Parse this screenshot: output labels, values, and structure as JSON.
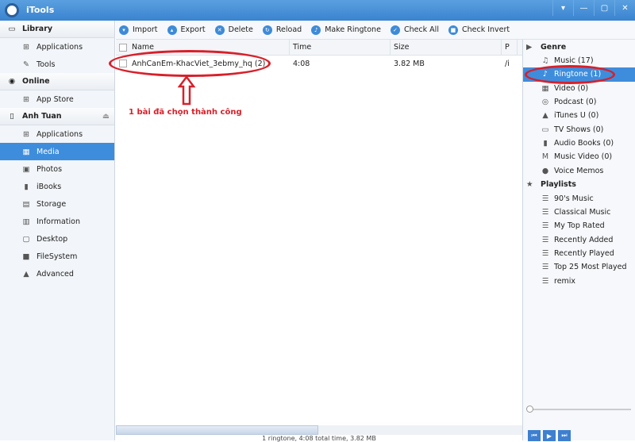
{
  "window": {
    "title": "iTools",
    "controls": [
      "▾",
      "—",
      "▢",
      "✕"
    ]
  },
  "sidebar": {
    "library": {
      "label": "Library",
      "items": [
        {
          "label": "Applications",
          "icon": "grid-icon"
        },
        {
          "label": "Tools",
          "icon": "wrench-icon"
        }
      ]
    },
    "online": {
      "label": "Online",
      "items": [
        {
          "label": "App Store",
          "icon": "grid-icon"
        }
      ]
    },
    "device": {
      "label": "Anh Tuan",
      "items": [
        {
          "label": "Applications"
        },
        {
          "label": "Media"
        },
        {
          "label": "Photos"
        },
        {
          "label": "iBooks"
        },
        {
          "label": "Storage"
        },
        {
          "label": "Information"
        },
        {
          "label": "Desktop"
        },
        {
          "label": "FileSystem"
        },
        {
          "label": "Advanced"
        }
      ],
      "selected": "Media"
    }
  },
  "toolbar": {
    "buttons": [
      "Import",
      "Export",
      "Delete",
      "Reload",
      "Make Ringtone",
      "Check All",
      "Check Invert"
    ]
  },
  "table": {
    "columns": [
      "Name",
      "Time",
      "Size",
      "P"
    ],
    "rows": [
      {
        "name": "AnhCanEm-KhacViet_3ebmy_hq (2)",
        "time": "4:08",
        "size": "3.82 MB",
        "path": "/i"
      }
    ]
  },
  "annotation": {
    "text": "1 bài đã chọn thành công",
    "color": "#d8202a"
  },
  "status": "1 ringtone, 4:08 total time, 3.82 MB",
  "genre": {
    "label": "Genre",
    "items": [
      "Music (17)",
      "Ringtone (1)",
      "Video (0)",
      "Podcast (0)",
      "iTunes U (0)",
      "TV Shows (0)",
      "Audio Books (0)",
      "Music Video (0)",
      "Voice Memos"
    ],
    "selected": "Ringtone (1)"
  },
  "playlists": {
    "label": "Playlists",
    "items": [
      "90's Music",
      "Classical Music",
      "My Top Rated",
      "Recently Added",
      "Recently Played",
      "Top 25 Most Played",
      "remix"
    ]
  },
  "accent": "#3e8ddd"
}
